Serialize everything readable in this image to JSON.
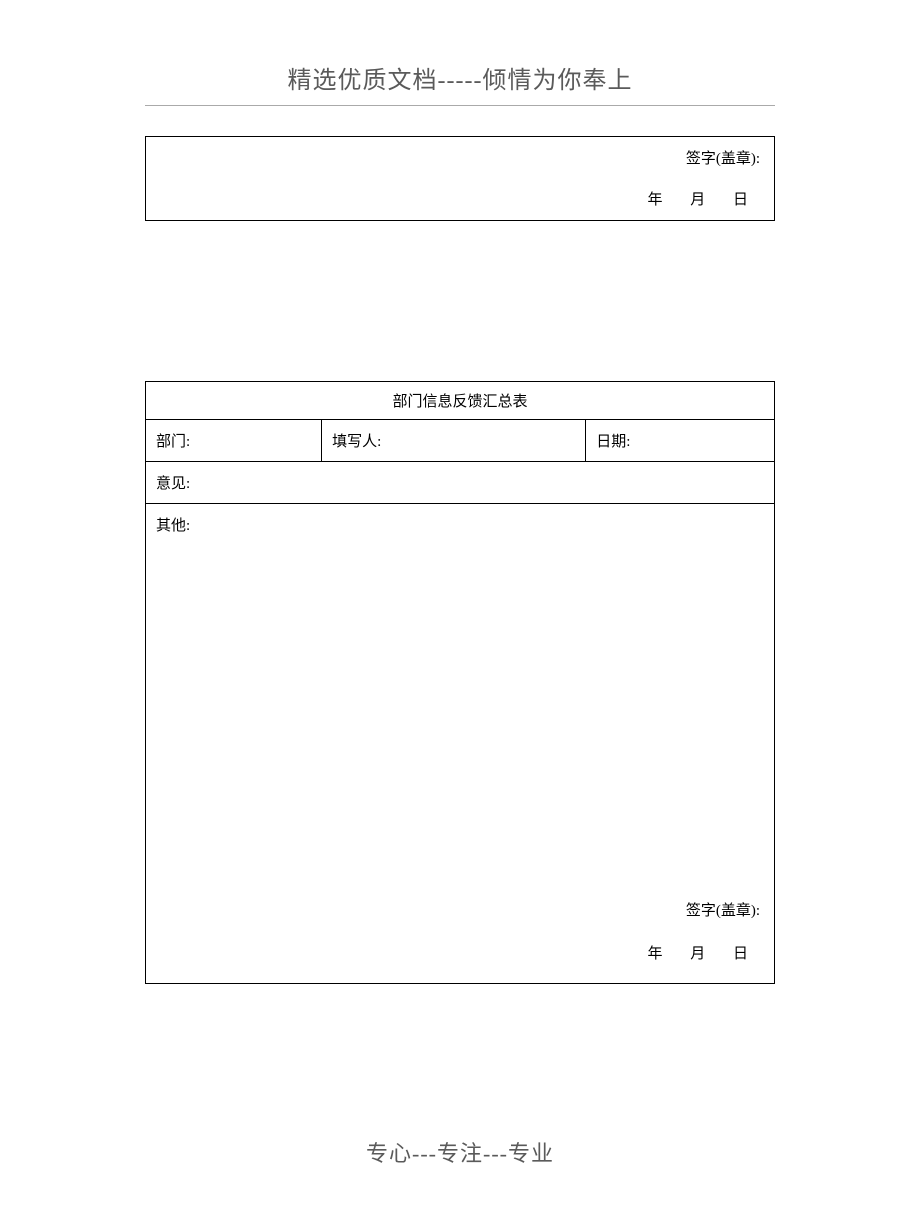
{
  "header": {
    "title": "精选优质文档-----倾情为你奉上"
  },
  "box1": {
    "signature_label": "签字(盖章):",
    "date_year": "年",
    "date_month": "月",
    "date_day": "日"
  },
  "table2": {
    "title": "部门信息反馈汇总表",
    "field_department": "部门:",
    "field_filler": "填写人:",
    "field_date": "日期:",
    "field_opinion": "意见:",
    "field_other": "其他:",
    "signature_label": "签字(盖章):",
    "date_year": "年",
    "date_month": "月",
    "date_day": "日"
  },
  "footer": {
    "text": "专心---专注---专业"
  }
}
